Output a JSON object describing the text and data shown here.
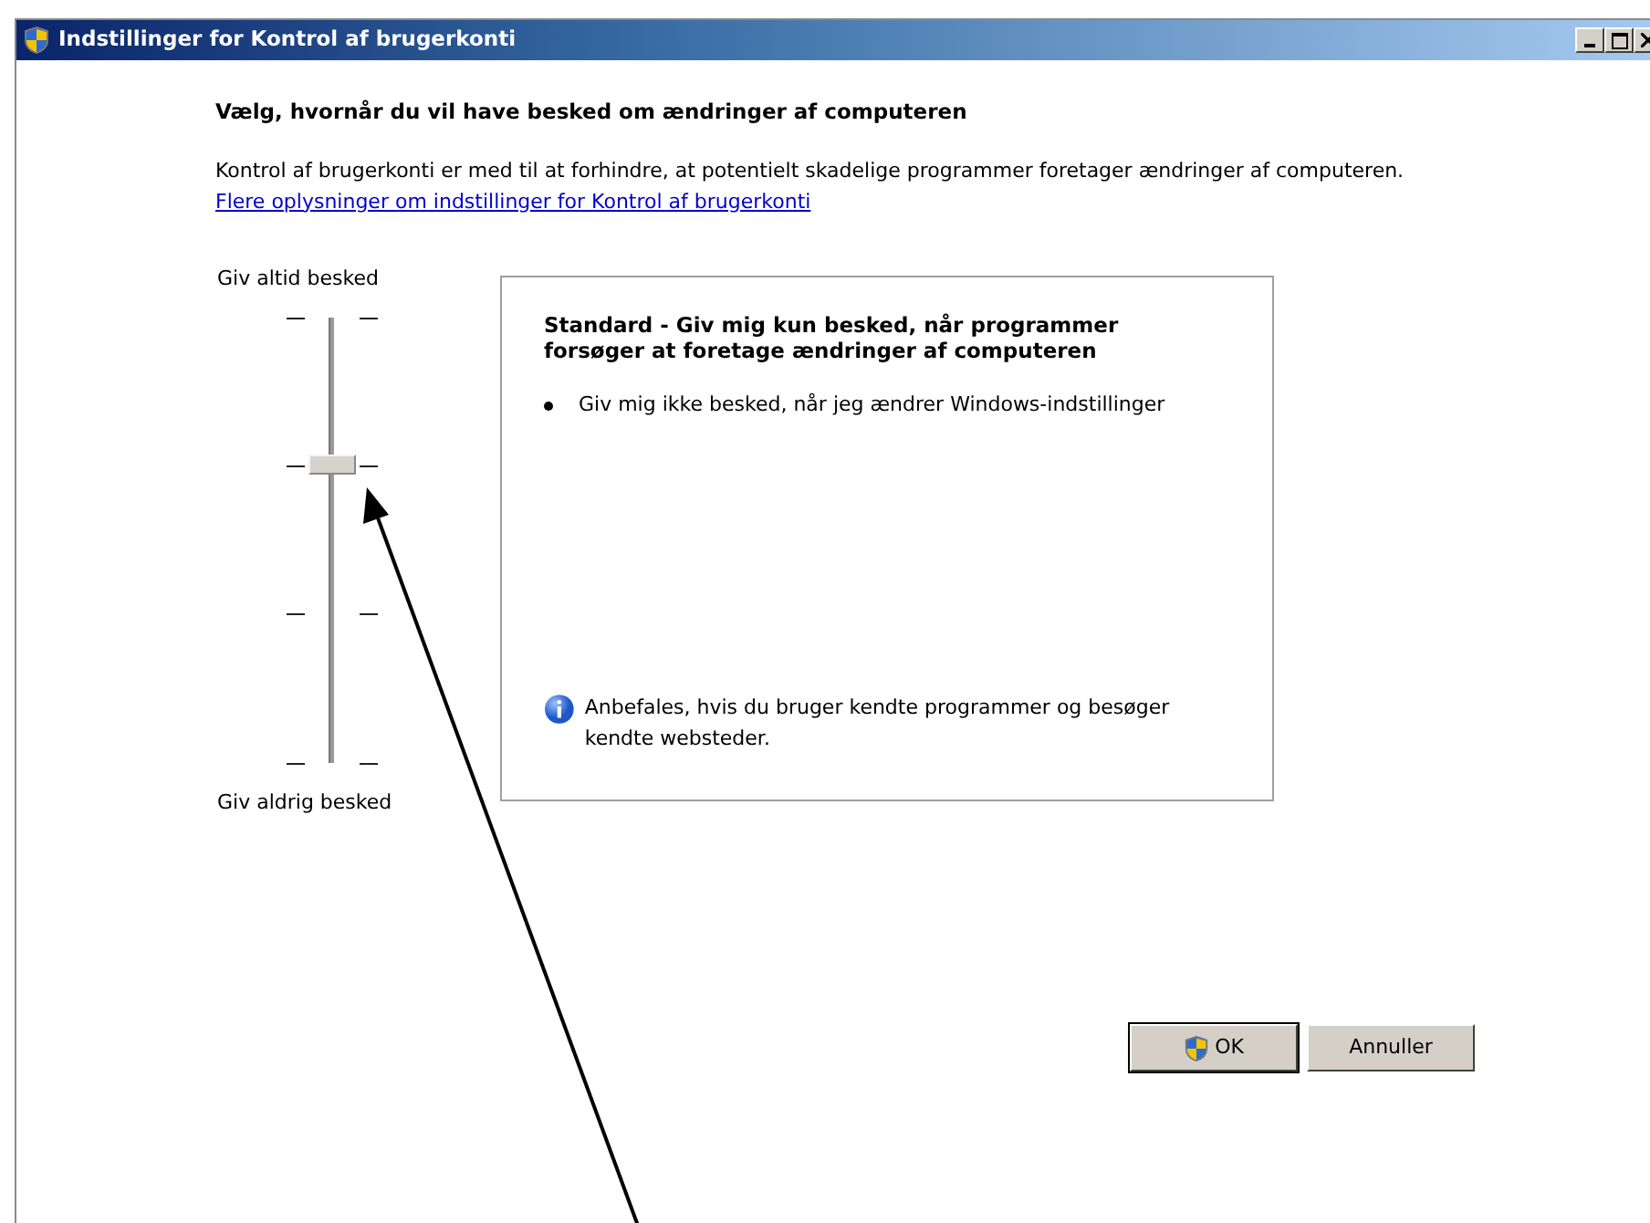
{
  "window": {
    "title": "Indstillinger for Kontrol af brugerkonti"
  },
  "heading": "Vælg, hvornår du vil have besked om ændringer af computeren",
  "description": "Kontrol af brugerkonti er med til at forhindre, at potentielt skadelige programmer foretager ændringer af computeren.",
  "link": "Flere oplysninger om indstillinger for Kontrol af brugerkonti",
  "slider": {
    "top_label": "Giv altid besked",
    "bottom_label": "Giv aldrig besked",
    "level": 0.667
  },
  "detail": {
    "title": "Standard - Giv mig kun besked, når programmer forsøger at foretage ændringer af computeren",
    "bullets": [
      "Giv mig ikke besked, når jeg ændrer Windows-indstillinger"
    ],
    "note": "Anbefales, hvis du bruger kendte programmer og besøger kendte websteder."
  },
  "buttons": [
    {
      "label": "OK",
      "kind": "shield"
    },
    {
      "label": "Annuller",
      "kind": "plain"
    }
  ]
}
